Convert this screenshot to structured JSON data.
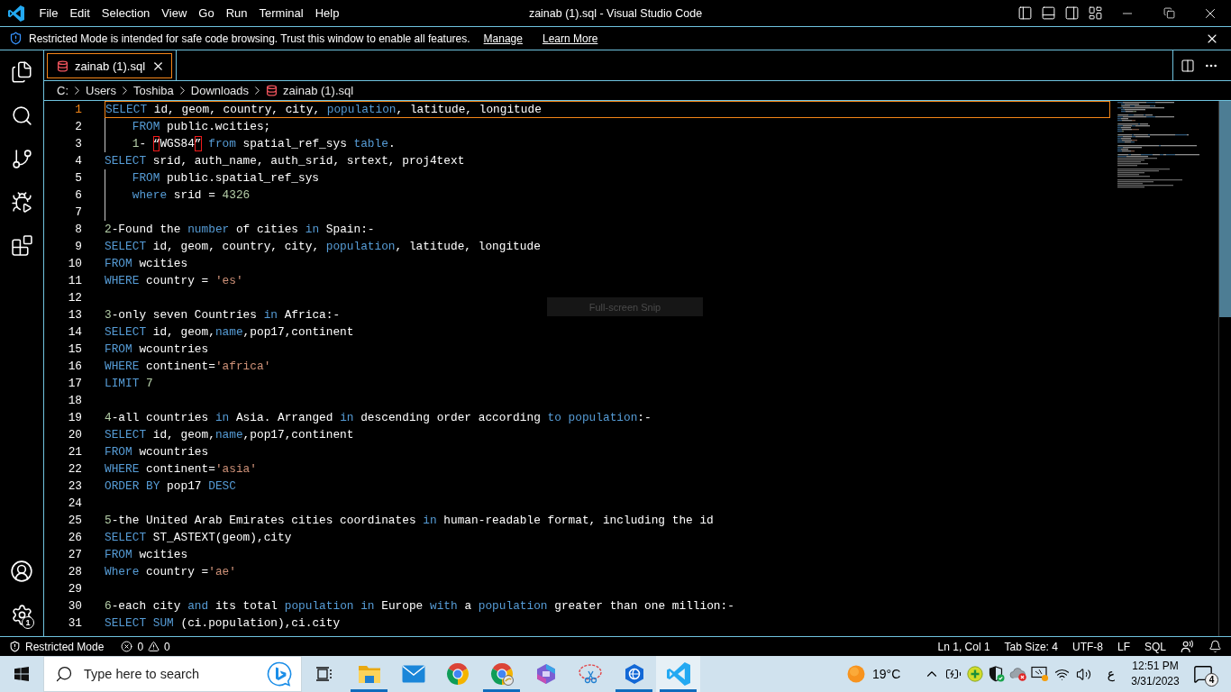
{
  "title_bar": {
    "menu": [
      "File",
      "Edit",
      "Selection",
      "View",
      "Go",
      "Run",
      "Terminal",
      "Help"
    ],
    "title": "zainab (1).sql - Visual Studio Code"
  },
  "banner": {
    "message": "Restricted Mode is intended for safe code browsing. Trust this window to enable all features.",
    "links": [
      "Manage",
      "Learn More"
    ]
  },
  "activity_bar": {
    "settings_badge": "1"
  },
  "tabs": [
    {
      "label": "zainab (1).sql",
      "selected": true
    }
  ],
  "breadcrumbs": [
    {
      "label": "C:",
      "kind": "folder"
    },
    {
      "label": "Users",
      "kind": "folder"
    },
    {
      "label": "Toshiba",
      "kind": "folder"
    },
    {
      "label": "Downloads",
      "kind": "folder"
    },
    {
      "label": "zainab (1).sql",
      "kind": "file"
    }
  ],
  "editor": {
    "lines": [
      {
        "number": "1",
        "current": true,
        "indented": false,
        "tokens": [
          {
            "kind": "keyword",
            "text": "SELECT"
          },
          {
            "kind": "plain",
            "text": " id, geom, country, city, "
          },
          {
            "kind": "keyword",
            "text": "population"
          },
          {
            "kind": "plain",
            "text": ", latitude, longitude"
          }
        ]
      },
      {
        "number": "2",
        "current": false,
        "indented": true,
        "tokens": [
          {
            "kind": "keyword",
            "text": "FROM"
          },
          {
            "kind": "plain",
            "text": " public.wcities;"
          }
        ]
      },
      {
        "number": "3",
        "current": false,
        "indented": true,
        "tokens": [
          {
            "kind": "number",
            "text": "1"
          },
          {
            "kind": "plain",
            "text": "- "
          },
          {
            "kind": "flagged",
            "text": "“"
          },
          {
            "kind": "plain",
            "text": "WGS84"
          },
          {
            "kind": "flagged",
            "text": "”"
          },
          {
            "kind": "keyword",
            "text": " from"
          },
          {
            "kind": "plain",
            "text": " spatial_ref_sys "
          },
          {
            "kind": "keyword",
            "text": "table"
          },
          {
            "kind": "plain",
            "text": "."
          }
        ]
      },
      {
        "number": "4",
        "current": false,
        "indented": false,
        "tokens": [
          {
            "kind": "keyword",
            "text": "SELECT"
          },
          {
            "kind": "plain",
            "text": " srid, auth_name, auth_srid, srtext, proj4text"
          }
        ]
      },
      {
        "number": "5",
        "current": false,
        "indented": true,
        "tokens": [
          {
            "kind": "keyword",
            "text": "FROM"
          },
          {
            "kind": "plain",
            "text": " public.spatial_ref_sys"
          }
        ]
      },
      {
        "number": "6",
        "current": false,
        "indented": true,
        "tokens": [
          {
            "kind": "keyword",
            "text": "where"
          },
          {
            "kind": "plain",
            "text": " srid = "
          },
          {
            "kind": "number",
            "text": "4326"
          }
        ]
      },
      {
        "number": "7",
        "current": false,
        "indented": true
      },
      {
        "number": "8",
        "current": false,
        "indented": false,
        "tokens": [
          {
            "kind": "number",
            "text": "2"
          },
          {
            "kind": "plain",
            "text": "-Found the "
          },
          {
            "kind": "keyword",
            "text": "number"
          },
          {
            "kind": "plain",
            "text": " of cities "
          },
          {
            "kind": "keyword",
            "text": "in"
          },
          {
            "kind": "plain",
            "text": " Spain:-"
          }
        ]
      },
      {
        "number": "9",
        "current": false,
        "indented": false,
        "tokens": [
          {
            "kind": "keyword",
            "text": "SELECT"
          },
          {
            "kind": "plain",
            "text": " id, geom, country, city, "
          },
          {
            "kind": "keyword",
            "text": "population"
          },
          {
            "kind": "plain",
            "text": ", latitude, longitude"
          }
        ]
      },
      {
        "number": "10",
        "current": false,
        "indented": false,
        "tokens": [
          {
            "kind": "keyword",
            "text": "FROM"
          },
          {
            "kind": "plain",
            "text": " wcities"
          }
        ]
      },
      {
        "number": "11",
        "current": false,
        "indented": false,
        "tokens": [
          {
            "kind": "keyword",
            "text": "WHERE"
          },
          {
            "kind": "plain",
            "text": " country = "
          },
          {
            "kind": "string",
            "text": "'es'"
          }
        ]
      },
      {
        "number": "12",
        "current": false,
        "indented": false
      },
      {
        "number": "13",
        "current": false,
        "indented": false,
        "tokens": [
          {
            "kind": "number",
            "text": "3"
          },
          {
            "kind": "plain",
            "text": "-only seven Countries "
          },
          {
            "kind": "keyword",
            "text": "in"
          },
          {
            "kind": "plain",
            "text": " Africa:-"
          }
        ]
      },
      {
        "number": "14",
        "current": false,
        "indented": false,
        "tokens": [
          {
            "kind": "keyword",
            "text": "SELECT"
          },
          {
            "kind": "plain",
            "text": " id, geom,"
          },
          {
            "kind": "keyword",
            "text": "name"
          },
          {
            "kind": "plain",
            "text": ",pop17,continent"
          }
        ]
      },
      {
        "number": "15",
        "current": false,
        "indented": false,
        "tokens": [
          {
            "kind": "keyword",
            "text": "FROM"
          },
          {
            "kind": "plain",
            "text": " wcountries"
          }
        ]
      },
      {
        "number": "16",
        "current": false,
        "indented": false,
        "tokens": [
          {
            "kind": "keyword",
            "text": "WHERE"
          },
          {
            "kind": "plain",
            "text": " continent="
          },
          {
            "kind": "string",
            "text": "'africa'"
          }
        ]
      },
      {
        "number": "17",
        "current": false,
        "indented": false,
        "tokens": [
          {
            "kind": "keyword",
            "text": "LIMIT"
          },
          {
            "kind": "number",
            "text": " 7"
          }
        ]
      },
      {
        "number": "18",
        "current": false,
        "indented": false
      },
      {
        "number": "19",
        "current": false,
        "indented": false,
        "tokens": [
          {
            "kind": "number",
            "text": "4"
          },
          {
            "kind": "plain",
            "text": "-all countries "
          },
          {
            "kind": "keyword",
            "text": "in"
          },
          {
            "kind": "plain",
            "text": " Asia. Arranged "
          },
          {
            "kind": "keyword",
            "text": "in"
          },
          {
            "kind": "plain",
            "text": " descending order according "
          },
          {
            "kind": "keyword",
            "text": "to population"
          },
          {
            "kind": "plain",
            "text": ":-"
          }
        ]
      },
      {
        "number": "20",
        "current": false,
        "indented": false,
        "tokens": [
          {
            "kind": "keyword",
            "text": "SELECT"
          },
          {
            "kind": "plain",
            "text": " id, geom,"
          },
          {
            "kind": "keyword",
            "text": "name"
          },
          {
            "kind": "plain",
            "text": ",pop17,continent"
          }
        ]
      },
      {
        "number": "21",
        "current": false,
        "indented": false,
        "tokens": [
          {
            "kind": "keyword",
            "text": "FROM"
          },
          {
            "kind": "plain",
            "text": " wcountries"
          }
        ]
      },
      {
        "number": "22",
        "current": false,
        "indented": false,
        "tokens": [
          {
            "kind": "keyword",
            "text": "WHERE"
          },
          {
            "kind": "plain",
            "text": " continent="
          },
          {
            "kind": "string",
            "text": "'asia'"
          }
        ]
      },
      {
        "number": "23",
        "current": false,
        "indented": false,
        "tokens": [
          {
            "kind": "keyword",
            "text": "ORDER BY"
          },
          {
            "kind": "plain",
            "text": " pop17 "
          },
          {
            "kind": "keyword",
            "text": "DESC"
          }
        ]
      },
      {
        "number": "24",
        "current": false,
        "indented": false
      },
      {
        "number": "25",
        "current": false,
        "indented": false,
        "tokens": [
          {
            "kind": "number",
            "text": "5"
          },
          {
            "kind": "plain",
            "text": "-the United Arab Emirates cities coordinates "
          },
          {
            "kind": "keyword",
            "text": "in"
          },
          {
            "kind": "plain",
            "text": " human-readable format, including the id"
          }
        ]
      },
      {
        "number": "26",
        "current": false,
        "indented": false,
        "tokens": [
          {
            "kind": "keyword",
            "text": "SELECT"
          },
          {
            "kind": "plain",
            "text": " ST_ASTEXT(geom),city"
          }
        ]
      },
      {
        "number": "27",
        "current": false,
        "indented": false,
        "tokens": [
          {
            "kind": "keyword",
            "text": "FROM"
          },
          {
            "kind": "plain",
            "text": " wcities"
          }
        ]
      },
      {
        "number": "28",
        "current": false,
        "indented": false,
        "tokens": [
          {
            "kind": "keyword",
            "text": "Where"
          },
          {
            "kind": "plain",
            "text": " country ="
          },
          {
            "kind": "string",
            "text": "'ae'"
          }
        ]
      },
      {
        "number": "29",
        "current": false,
        "indented": false
      },
      {
        "number": "30",
        "current": false,
        "indented": false,
        "tokens": [
          {
            "kind": "number",
            "text": "6"
          },
          {
            "kind": "plain",
            "text": "-each city "
          },
          {
            "kind": "keyword",
            "text": "and"
          },
          {
            "kind": "plain",
            "text": " its total "
          },
          {
            "kind": "keyword",
            "text": "population in"
          },
          {
            "kind": "plain",
            "text": " Europe "
          },
          {
            "kind": "keyword",
            "text": "with"
          },
          {
            "kind": "plain",
            "text": " a "
          },
          {
            "kind": "keyword",
            "text": "population"
          },
          {
            "kind": "plain",
            "text": " greater than one million:-"
          }
        ]
      },
      {
        "number": "31",
        "current": false,
        "indented": false,
        "tokens": [
          {
            "kind": "keyword",
            "text": "SELECT SUM"
          },
          {
            "kind": "plain",
            "text": " (ci.population),ci.city"
          }
        ]
      }
    ]
  },
  "snip_tooltip": "Full-screen Snip",
  "status_bar": {
    "restricted_mode": "Restricted Mode",
    "errors": "0",
    "warnings": "0",
    "items": [
      "Ln 1, Col 1",
      "Tab Size: 4",
      "UTF-8",
      "LF",
      "SQL"
    ]
  },
  "taskbar": {
    "search": {
      "placeholder": "Type here to search"
    },
    "apps": [
      {
        "kind": "explorer",
        "running": true,
        "selected": false
      },
      {
        "kind": "mail",
        "running": false,
        "selected": false
      },
      {
        "kind": "chrome",
        "running": false,
        "selected": false
      },
      {
        "kind": "chrome-profile",
        "running": true,
        "selected": false
      },
      {
        "kind": "hexagon",
        "running": false,
        "selected": false
      },
      {
        "kind": "snip",
        "running": false,
        "selected": false
      },
      {
        "kind": "globe",
        "running": true,
        "selected": false
      },
      {
        "kind": "vscode",
        "running": true,
        "selected": true
      }
    ],
    "weather": "19°C",
    "language": "ع",
    "time": "12:51 PM",
    "date": "3/31/2023",
    "notifications": "4"
  }
}
